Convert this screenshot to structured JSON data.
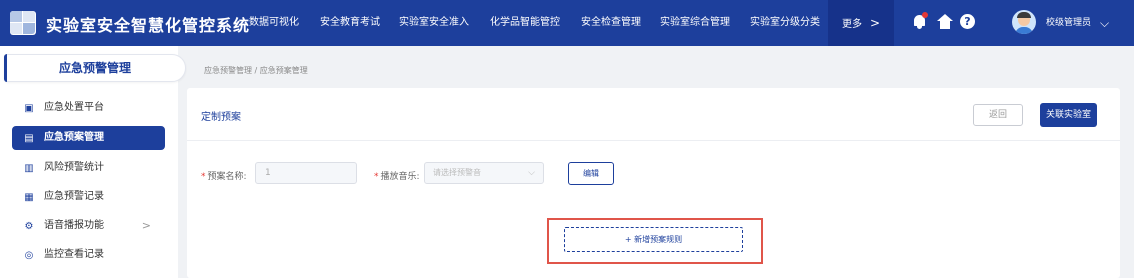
{
  "header": {
    "title": "实验室安全智慧化管控系统",
    "nav": [
      "数据可视化",
      "安全教育考试",
      "实验室安全准入",
      "化学品智能管控",
      "安全检查管理",
      "实验室综合管理",
      "实验室分级分类"
    ],
    "more_label": "更多",
    "user_name": "校级管理员"
  },
  "sidebar": {
    "section_title": "应急预警管理",
    "items": [
      {
        "label": "应急处置平台",
        "icon": "monitor-icon"
      },
      {
        "label": "应急预案管理",
        "icon": "document-icon"
      },
      {
        "label": "风险预警统计",
        "icon": "bar-chart-icon"
      },
      {
        "label": "应急预警记录",
        "icon": "clipboard-icon"
      },
      {
        "label": "语音播报功能",
        "icon": "gear-icon"
      },
      {
        "label": "监控查看记录",
        "icon": "camera-icon"
      }
    ]
  },
  "breadcrumb": "应急预警管理 / 应急预案管理",
  "card": {
    "title": "定制预案",
    "back_label": "返回",
    "link_label": "关联实验室",
    "name_label": "预案名称:",
    "name_value": "1",
    "music_label": "播放音乐:",
    "music_placeholder": "请选择预警音",
    "edit_label": "编辑",
    "add_rule_label": "+ 新增预案规则"
  },
  "colors": {
    "primary": "#1d3f9c",
    "required": "#e53935",
    "highlight": "#e0554a"
  }
}
